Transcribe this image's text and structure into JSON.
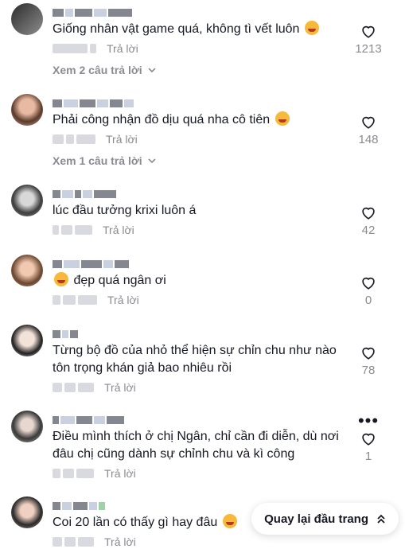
{
  "comments": [
    {
      "text": "Giống nhân vật game quá, không tì vết luôn",
      "emoji": true,
      "reply": "Trả lời",
      "likes": "1213",
      "view_replies": "Xem 2 câu trả lời"
    },
    {
      "text": "Phải công nhận đồ dịu quá nha cô tiên",
      "emoji": true,
      "reply": "Trả lời",
      "likes": "148",
      "view_replies": "Xem 1 câu trả lời"
    },
    {
      "text": "lúc đầu tưởng krixi luôn á",
      "emoji": false,
      "reply": "Trả lời",
      "likes": "42"
    },
    {
      "text": "đẹp quá ngân ơi",
      "emoji": true,
      "reply": "Trả lời",
      "likes": "0"
    },
    {
      "text": "Từng bộ đồ của nhỏ thể hiện sự chỉn chu như nào tôn trọng khán giả bao nhiêu rồi",
      "emoji": false,
      "reply": "Trả lời",
      "likes": "78"
    },
    {
      "text": "Điều mình thích ở chị Ngân, chỉ cần đi diễn, dù nơi đâu chị cũng dành sự chỉnh chu và kì công",
      "emoji": false,
      "reply": "Trả lời",
      "likes": "1"
    },
    {
      "text": "Coi 20 lần có thấy gì hay đâu",
      "emoji": true,
      "reply": "Trả lời",
      "likes": ""
    }
  ],
  "back_to_top": "Quay lại đầu trang",
  "icons": {
    "like": "heart-outline-icon",
    "chevron": "chevron-down-icon",
    "more": "more-dots-icon",
    "back": "double-chevron-up-icon"
  }
}
